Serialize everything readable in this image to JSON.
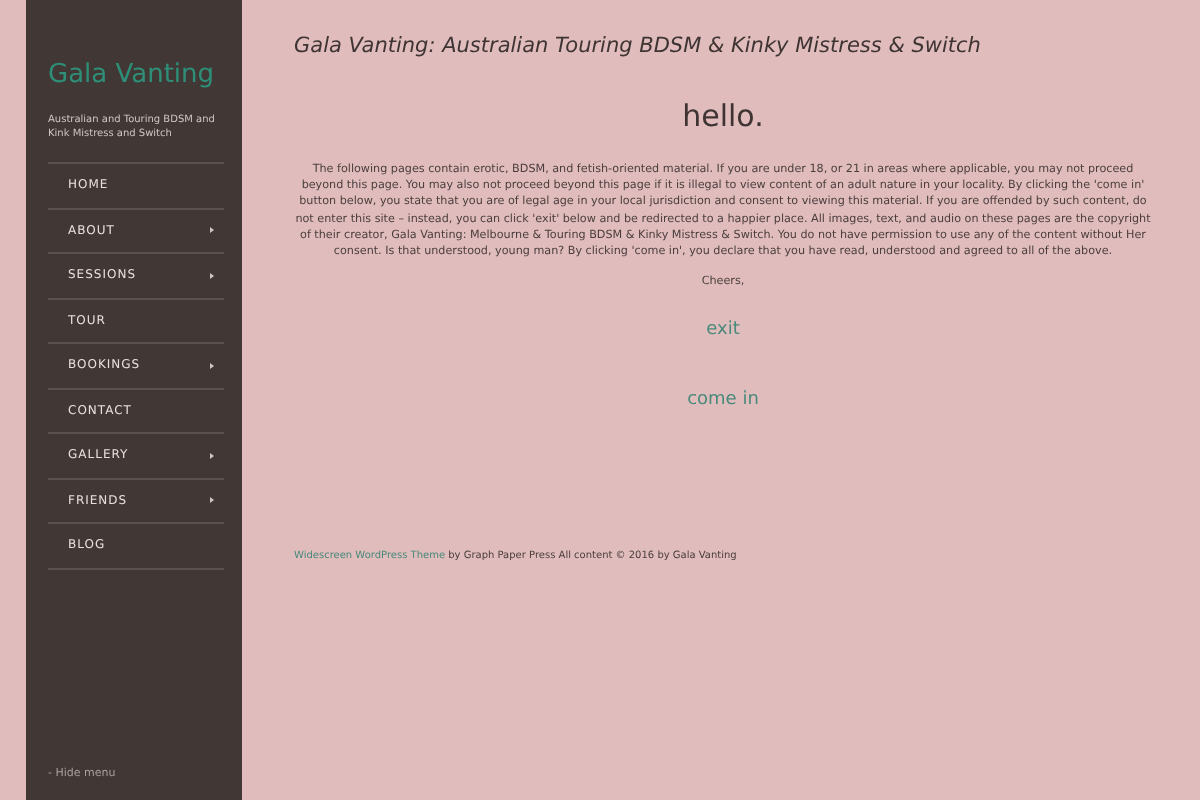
{
  "sidebar": {
    "site_title": "Gala Vanting",
    "tagline": "Australian and Touring BDSM and Kink Mistress and Switch",
    "menu": [
      {
        "label": "HOME",
        "has_submenu": false
      },
      {
        "label": "ABOUT",
        "has_submenu": true
      },
      {
        "label": "SESSIONS",
        "has_submenu": true
      },
      {
        "label": "TOUR",
        "has_submenu": false
      },
      {
        "label": "BOOKINGS",
        "has_submenu": true
      },
      {
        "label": "CONTACT",
        "has_submenu": false
      },
      {
        "label": "GALLERY",
        "has_submenu": true
      },
      {
        "label": "FRIENDS",
        "has_submenu": true
      },
      {
        "label": "BLOG",
        "has_submenu": false
      }
    ],
    "hide_menu": "- Hide menu"
  },
  "main": {
    "page_title": "Gala Vanting: Australian Touring BDSM & Kinky Mistress & Switch",
    "heading": "hello.",
    "body": "The following pages contain erotic, BDSM, and fetish-oriented material.  If you are under 18, or 21 in areas where applicable, you may not proceed beyond this page.  You may also not proceed beyond this page if it is illegal to view content of an adult nature in your locality.  By clicking the 'come in' button below, you state that you are of legal age in your local jurisdiction and consent to viewing this material.  If you are offended by such content, do not enter this site – instead, you can click 'exit' below and be redirected to a happier place.  All images, text, and audio on these pages are the copyright of their creator, Gala Vanting: Melbourne & Touring BDSM & Kinky Mistress & Switch.  You do not have permission to use any of the content without Her consent.  Is that understood, young man?  By clicking 'come in', you declare that you have read, understood and agreed to all of the above.",
    "signoff": "Cheers,",
    "exit_link": "exit",
    "enter_link": "come in"
  },
  "footer": {
    "theme_link": "Widescreen WordPress Theme",
    "text": " by Graph Paper Press All content © 2016 by Gala Vanting"
  }
}
